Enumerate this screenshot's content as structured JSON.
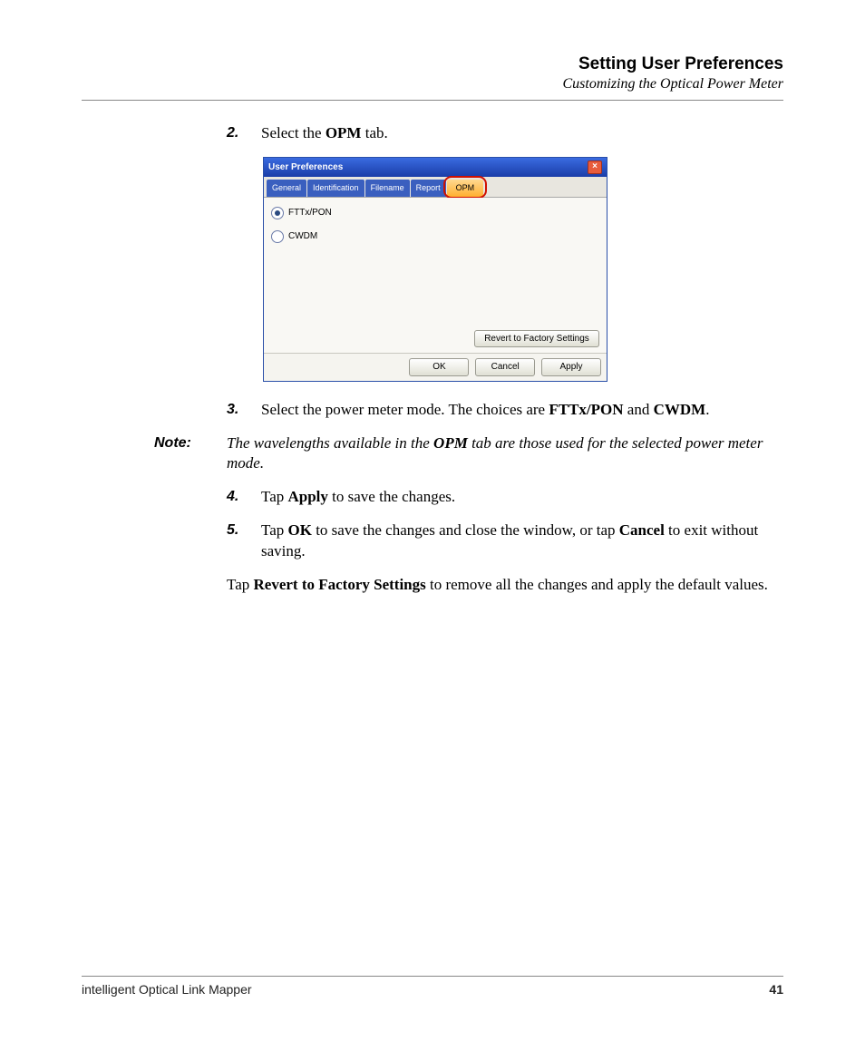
{
  "header": {
    "chapter": "Setting User Preferences",
    "subtitle": "Customizing the Optical Power Meter"
  },
  "steps": {
    "s2_num": "2.",
    "s2_a": "Select the ",
    "s2_b": "OPM",
    "s2_c": " tab.",
    "s3_num": "3.",
    "s3_a": "Select the power meter mode. The choices are ",
    "s3_b": "FTTx/PON",
    "s3_c": " and ",
    "s3_d": "CWDM",
    "s3_e": ".",
    "s4_num": "4.",
    "s4_a": "Tap ",
    "s4_b": "Apply",
    "s4_c": " to save the changes.",
    "s5_num": "5.",
    "s5_a": "Tap ",
    "s5_b": "OK",
    "s5_c": " to save the changes and close the window, or tap ",
    "s5_d": "Cancel",
    "s5_e": " to exit without saving."
  },
  "note": {
    "label": "Note:",
    "a": "The wavelengths available in the ",
    "b": "OPM",
    "c": " tab are those used for the selected power meter mode."
  },
  "para": {
    "a": "Tap ",
    "b": "Revert to Factory Settings",
    "c": " to remove all the changes and apply the default values."
  },
  "dialog": {
    "title": "User Preferences",
    "close": "×",
    "tabs": {
      "general": "General",
      "identification": "Identification",
      "filename": "Filename",
      "report": "Report",
      "opm": "OPM"
    },
    "options": {
      "fttx": "FTTx/PON",
      "cwdm": "CWDM"
    },
    "buttons": {
      "revert": "Revert to Factory Settings",
      "ok": "OK",
      "cancel": "Cancel",
      "apply": "Apply"
    }
  },
  "footer": {
    "product": "intelligent Optical Link Mapper",
    "page": "41"
  }
}
